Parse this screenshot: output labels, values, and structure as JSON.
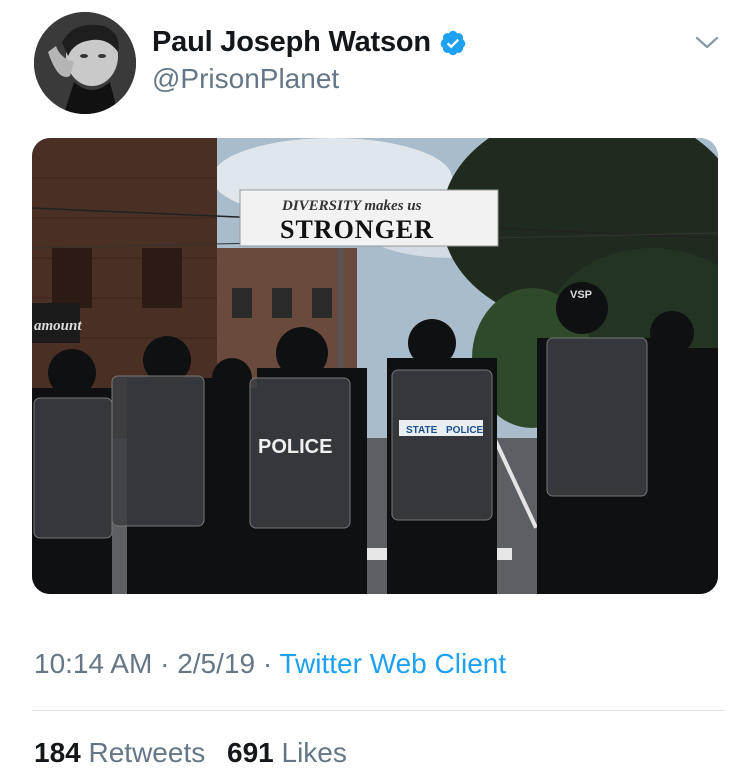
{
  "tweet": {
    "author_name": "Paul Joseph Watson",
    "author_handle": "@PrisonPlanet",
    "verified": true,
    "time": "10:14 AM",
    "separator": "·",
    "date": "2/5/19",
    "client": "Twitter Web Client",
    "retweets_count": "184",
    "retweets_label": "Retweets",
    "likes_count": "691",
    "likes_label": "Likes"
  },
  "photo": {
    "banner_line1": "DIVERSITY makes us",
    "banner_line2": "STRONGER",
    "shield_text": "POLICE",
    "shield_sub_left": "STATE",
    "shield_sub_right": "POLICE",
    "helmet_text": "VSP",
    "store_sign": "amount"
  },
  "colors": {
    "accent": "#1da1f2",
    "secondary_text": "#657786",
    "primary_text": "#14171a",
    "divider": "#e1e8ed"
  },
  "icons": {
    "verified": "verified-badge-icon",
    "menu": "chevron-down-icon"
  }
}
